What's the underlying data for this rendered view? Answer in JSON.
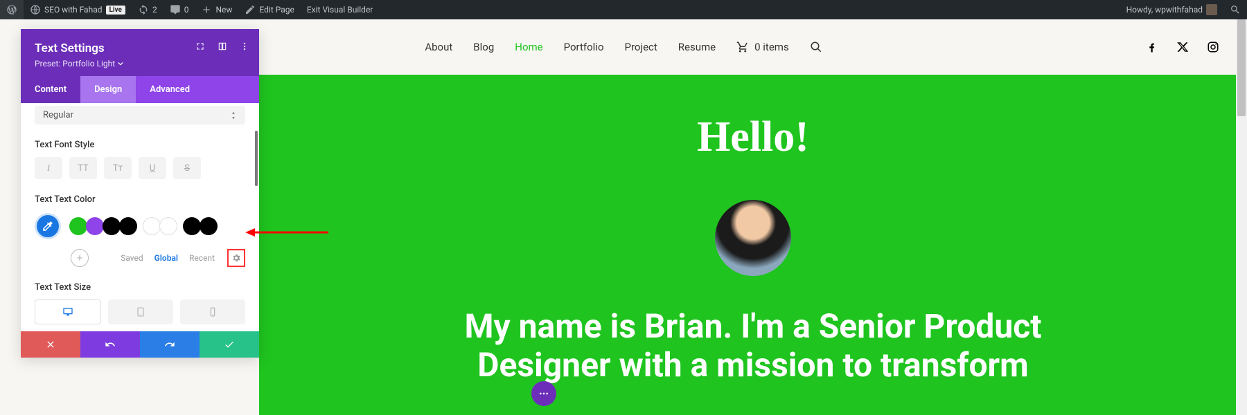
{
  "wpbar": {
    "site_name": "SEO with Fahad",
    "live": "Live",
    "updates_count": "2",
    "comments_count": "0",
    "new": "New",
    "edit_page": "Edit Page",
    "exit_vb": "Exit Visual Builder",
    "howdy": "Howdy, wpwithfahad"
  },
  "nav": {
    "items": [
      "About",
      "Blog",
      "Home",
      "Portfolio",
      "Project",
      "Resume"
    ],
    "active_index": 2,
    "cart_label": "0 items"
  },
  "hero": {
    "hello": "Hello!",
    "intro_line1": "My name is Brian. I'm a Senior Product",
    "intro_line2": "Designer with a mission to transform"
  },
  "panel": {
    "title": "Text Settings",
    "preset": "Preset: Portfolio Light",
    "tabs": {
      "content": "Content",
      "design": "Design",
      "advanced": "Advanced"
    },
    "font_weight": "Regular",
    "label_font_style": "Text Font Style",
    "label_text_color": "Text Text Color",
    "label_text_size": "Text Text Size",
    "color_tabs": {
      "saved": "Saved",
      "global": "Global",
      "recent": "Recent"
    },
    "style_btns": {
      "italic": "I",
      "uppercase": "TT",
      "smallcaps": "Tт",
      "underline": "U",
      "strike": "S"
    },
    "swatches": [
      "#1fc41f",
      "#8e44e8",
      "#000000",
      "#000000",
      "#ffffff",
      "#ffffff",
      "#000000",
      "#000000"
    ]
  }
}
